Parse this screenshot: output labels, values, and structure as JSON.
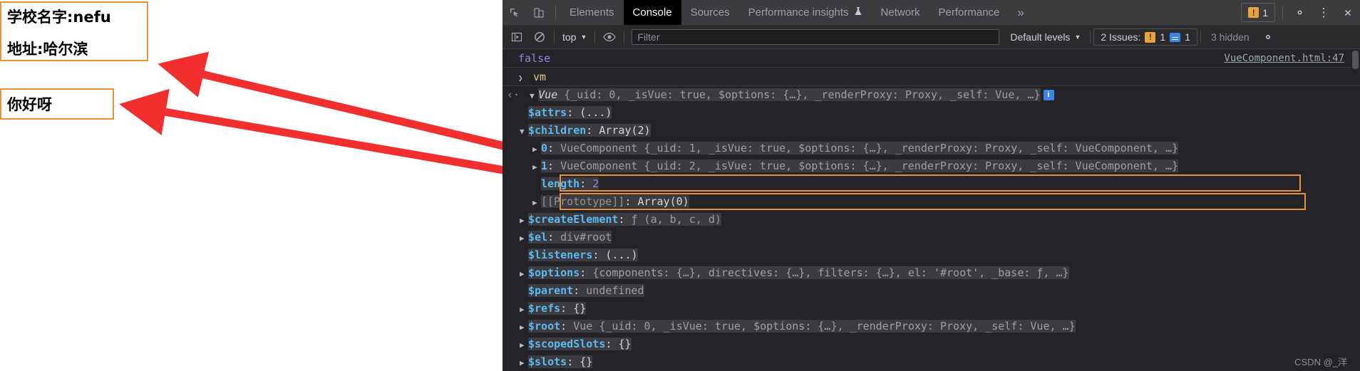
{
  "page": {
    "school_box": {
      "line1": "学校名字:nefu",
      "line2": "地址:哈尔滨"
    },
    "hello_box": {
      "line1": "你好呀"
    },
    "border_color": "#e8913a"
  },
  "devtools": {
    "tabs": [
      {
        "label": "Elements",
        "active": false
      },
      {
        "label": "Console",
        "active": true
      },
      {
        "label": "Sources",
        "active": false
      },
      {
        "label": "Performance insights",
        "active": false,
        "flask": "⚗"
      },
      {
        "label": "Network",
        "active": false
      },
      {
        "label": "Performance",
        "active": false
      }
    ],
    "more_label": "»",
    "inspect_icon": "inspect-element-icon",
    "device_icon": "device-toolbar-icon",
    "issues_badge": {
      "count": "1",
      "icon": "warning-icon"
    },
    "settings_icon": "gear-icon",
    "kebab_icon": "more-options-icon",
    "close_icon": "close-icon",
    "filterbar": {
      "sidebar_icon": "console-sidebar-icon",
      "clear_icon": "clear-console-icon",
      "context": "top",
      "context_caret": "▼",
      "eye_icon": "live-expression-icon",
      "filter_placeholder": "Filter",
      "filter_value": "",
      "levels": "Default levels",
      "levels_caret": "▼",
      "issues_label": "2 Issues:",
      "issues_warn_count": "1",
      "issues_info_count": "1",
      "hidden_label": "3 hidden",
      "settings_icon": "console-settings-icon"
    },
    "console": {
      "source_link": "VueComponent.html:47",
      "rows": [
        {
          "kind": "result",
          "text": "false"
        },
        {
          "kind": "input",
          "text": "vm"
        }
      ],
      "vue_header": {
        "ctor": "Vue",
        "body": "{_uid: 0, _isVue: true, $options: {…}, _renderProxy: Proxy, _self: Vue, …}",
        "info_badge": "i"
      },
      "props": [
        {
          "name": "$attrs",
          "value": "(...)",
          "expandable": false,
          "indent": 1
        },
        {
          "name": "$children",
          "value": "Array(2)",
          "expandable": true,
          "expanded": true,
          "indent": 1
        },
        {
          "name": "0",
          "value": "VueComponent {_uid: 1, _isVue: true, $options: {…}, _renderProxy: Proxy, _self: VueComponent, …}",
          "expandable": true,
          "indent": 2,
          "boxed": true
        },
        {
          "name": "1",
          "value": "VueComponent {_uid: 2, _isVue: true, $options: {…}, _renderProxy: Proxy, _self: VueComponent, …}",
          "expandable": true,
          "indent": 2,
          "boxed": true
        },
        {
          "name": "length",
          "value": "2",
          "expandable": false,
          "indent": 2
        },
        {
          "name": "[[Prototype]]",
          "value": "Array(0)",
          "expandable": true,
          "indent": 2
        },
        {
          "name": "$createElement",
          "value": "ƒ (a, b, c, d)",
          "expandable": true,
          "indent": 1
        },
        {
          "name": "$el",
          "value": "div#root",
          "expandable": true,
          "indent": 1
        },
        {
          "name": "$listeners",
          "value": "(...)",
          "expandable": false,
          "indent": 1
        },
        {
          "name": "$options",
          "value": "{components: {…}, directives: {…}, filters: {…}, el: '#root', _base: ƒ, …}",
          "expandable": true,
          "indent": 1
        },
        {
          "name": "$parent",
          "value": "undefined",
          "expandable": false,
          "indent": 1
        },
        {
          "name": "$refs",
          "value": "{}",
          "expandable": true,
          "indent": 1
        },
        {
          "name": "$root",
          "value": "Vue {_uid: 0, _isVue: true, $options: {…}, _renderProxy: Proxy, _self: Vue, …}",
          "expandable": true,
          "indent": 1
        },
        {
          "name": "$scopedSlots",
          "value": "{}",
          "expandable": true,
          "indent": 1
        },
        {
          "name": "$slots",
          "value": "{}",
          "expandable": true,
          "indent": 1
        }
      ]
    },
    "watermark": "CSDN @_洋"
  }
}
